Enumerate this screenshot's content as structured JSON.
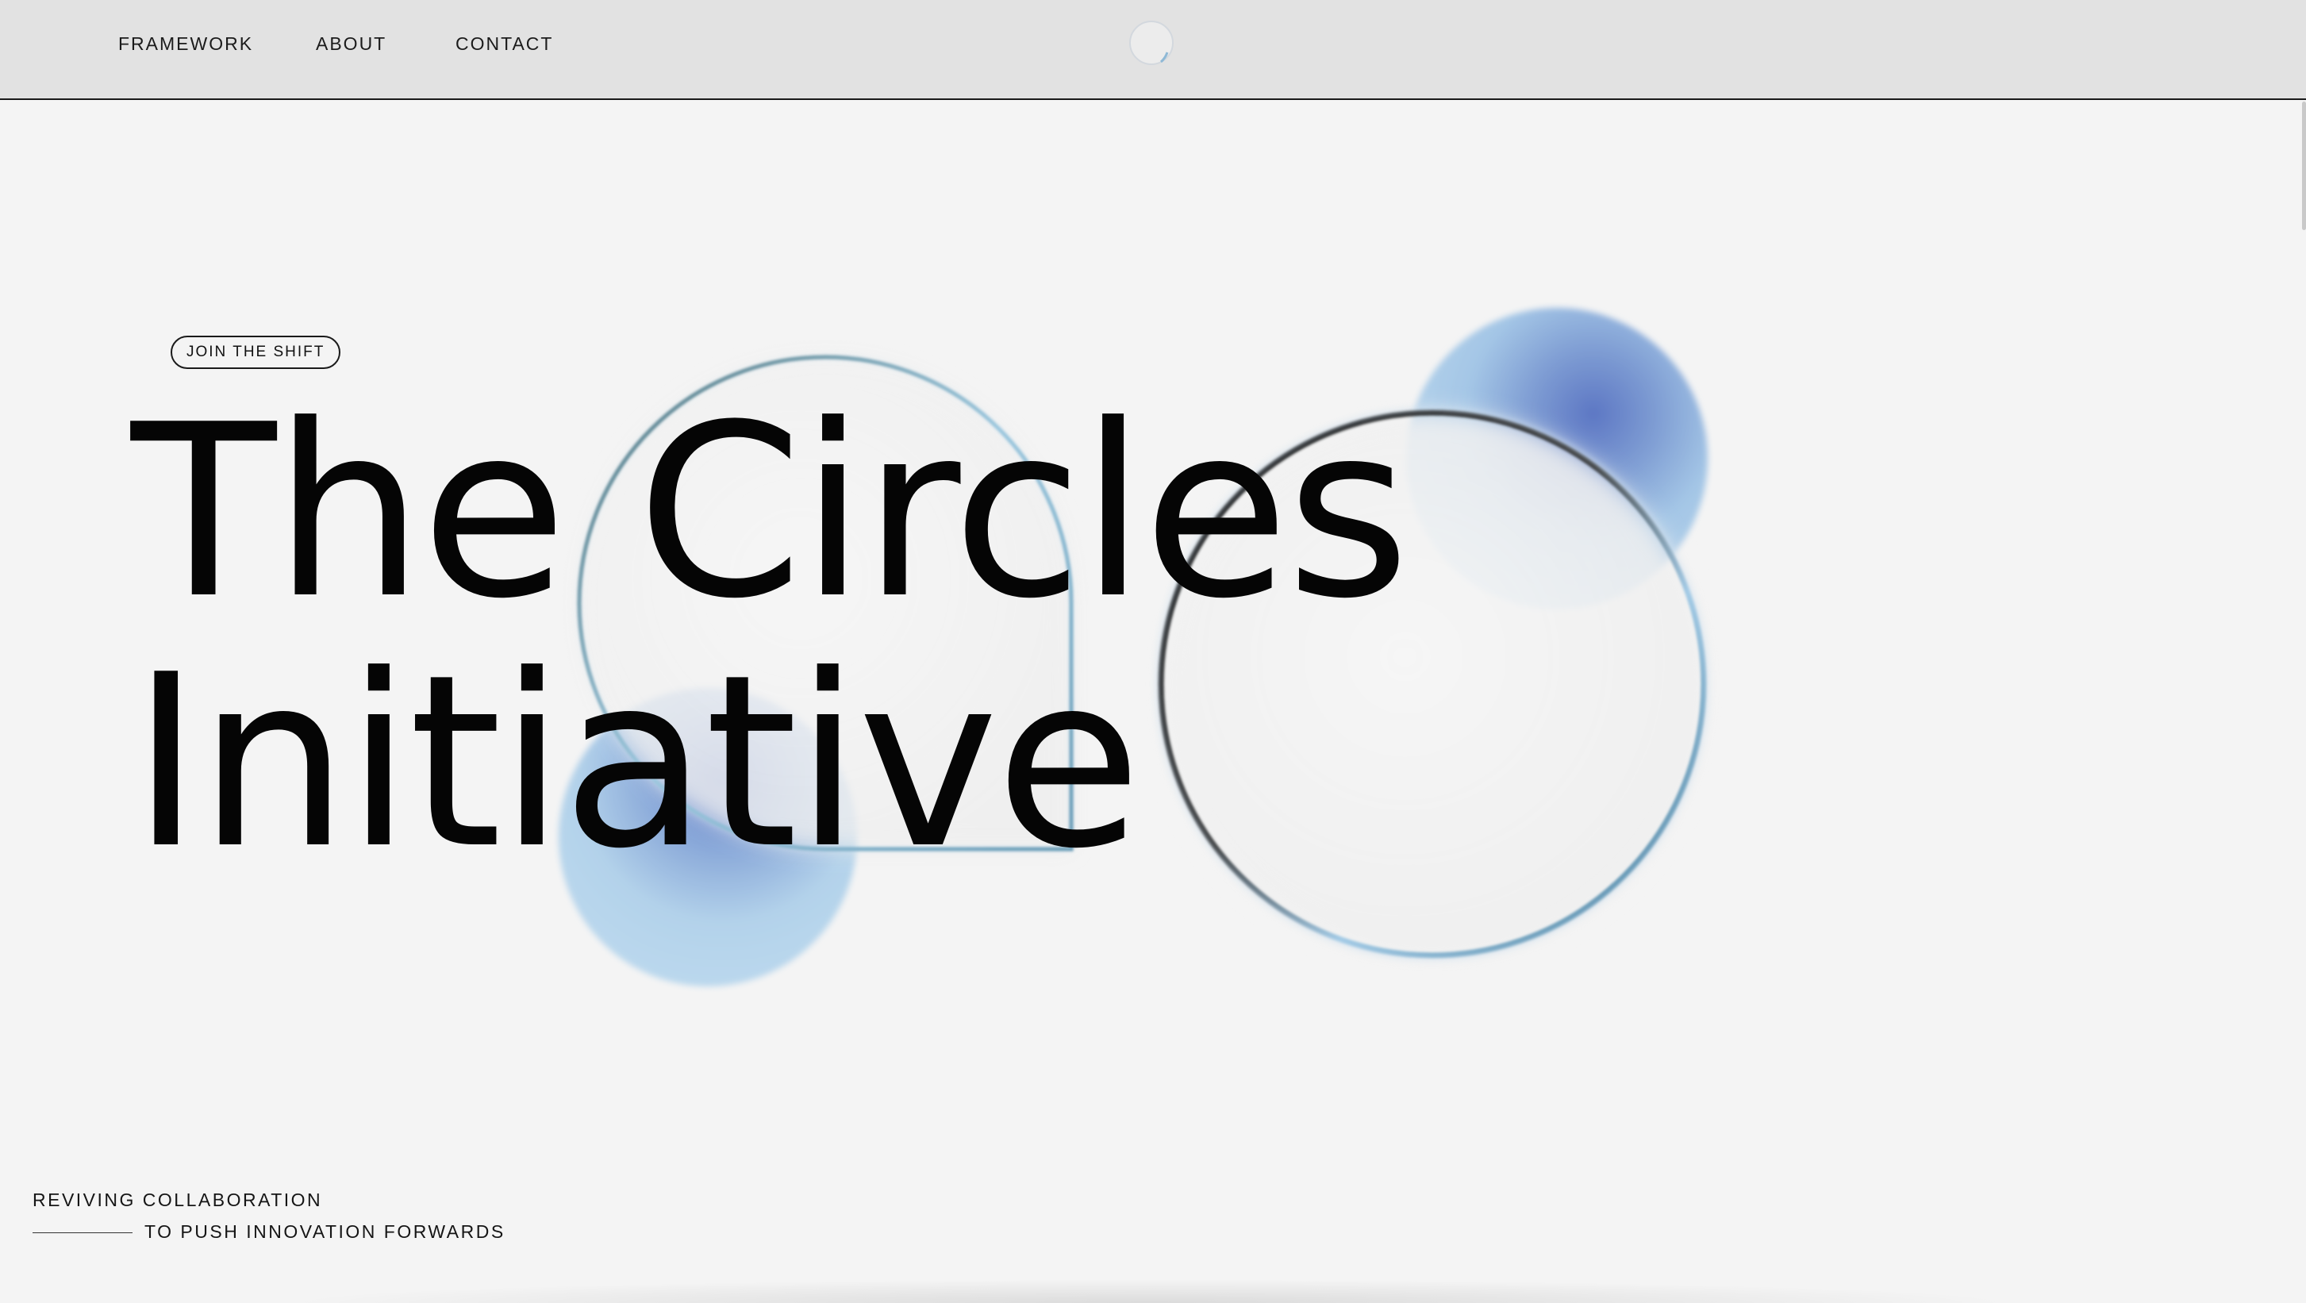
{
  "nav": {
    "items": [
      {
        "label": "FRAMEWORK"
      },
      {
        "label": "ABOUT"
      },
      {
        "label": "CONTACT"
      }
    ],
    "logo_icon": "circle-logo-icon"
  },
  "hero": {
    "badge": "JOIN THE SHIFT",
    "title_line_1": "The Circles",
    "title_line_2": "Initiative"
  },
  "tagline": {
    "line_1": "REVIVING COLLABORATION",
    "line_2": "TO PUSH INNOVATION FORWARDS"
  },
  "colors": {
    "header_bg": "#e2e2e2",
    "page_bg": "#f4f4f4",
    "text": "#050505",
    "accent_blue": "#6a86cc",
    "soft_blue": "#b3d3ea"
  }
}
